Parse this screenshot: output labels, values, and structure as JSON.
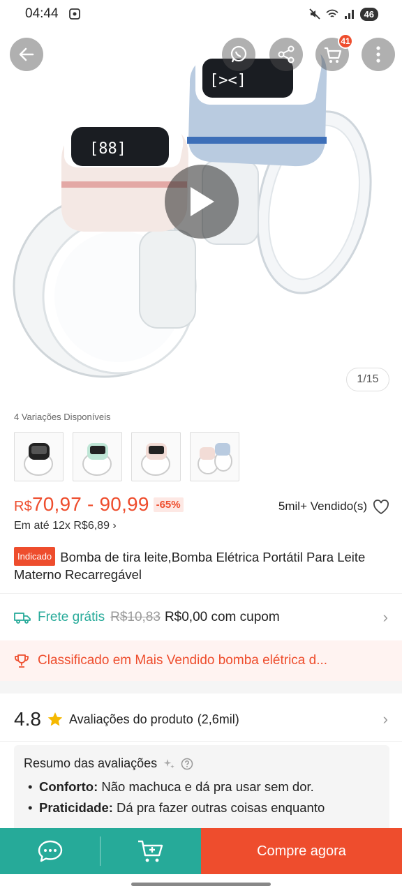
{
  "status_bar": {
    "time": "04:44",
    "battery": "46"
  },
  "header": {
    "back_icon": "arrow-left-icon",
    "whatsapp_icon": "whatsapp-icon",
    "share_icon": "share-icon",
    "cart_icon": "cart-icon",
    "cart_count": "41",
    "more_icon": "more-vertical-icon"
  },
  "gallery": {
    "counter": "1/15",
    "play_icon": "play-icon"
  },
  "variations": {
    "label": "4 Variações Disponíveis",
    "items": [
      "black-pump",
      "green-pump",
      "pink-pump",
      "pink-blue-pump"
    ]
  },
  "price": {
    "currency": "R$",
    "range": "70,97 - 90,99",
    "discount": "-65%",
    "sold": "5mil+ Vendido(s)",
    "installment": "Em até 12x R$6,89 ›"
  },
  "product": {
    "tag": "Indicado",
    "title": "Bomba de tira leite,Bomba Elétrica Portátil Para Leite Materno Recarregável"
  },
  "shipping": {
    "label": "Frete grátis",
    "old_price": "R$10,83",
    "new_price": "R$0,00 com cupom"
  },
  "ranking": {
    "text": "Classificado em Mais Vendido bomba elétrica d..."
  },
  "rating": {
    "score": "4.8",
    "label": "Avaliações do produto",
    "count": "(2,6mil)"
  },
  "summary": {
    "title": "Resumo das avaliações",
    "items": [
      {
        "key": "Conforto:",
        "text": " Não machuca e dá pra usar sem dor."
      },
      {
        "key": "Praticidade:",
        "text": " Dá pra fazer outras coisas enquanto"
      }
    ]
  },
  "bottom_bar": {
    "chat_icon": "chat-icon",
    "add_cart_icon": "add-to-cart-icon",
    "buy_label": "Compre agora"
  },
  "colors": {
    "accent": "#ee4d2d",
    "teal": "#26aa99"
  }
}
